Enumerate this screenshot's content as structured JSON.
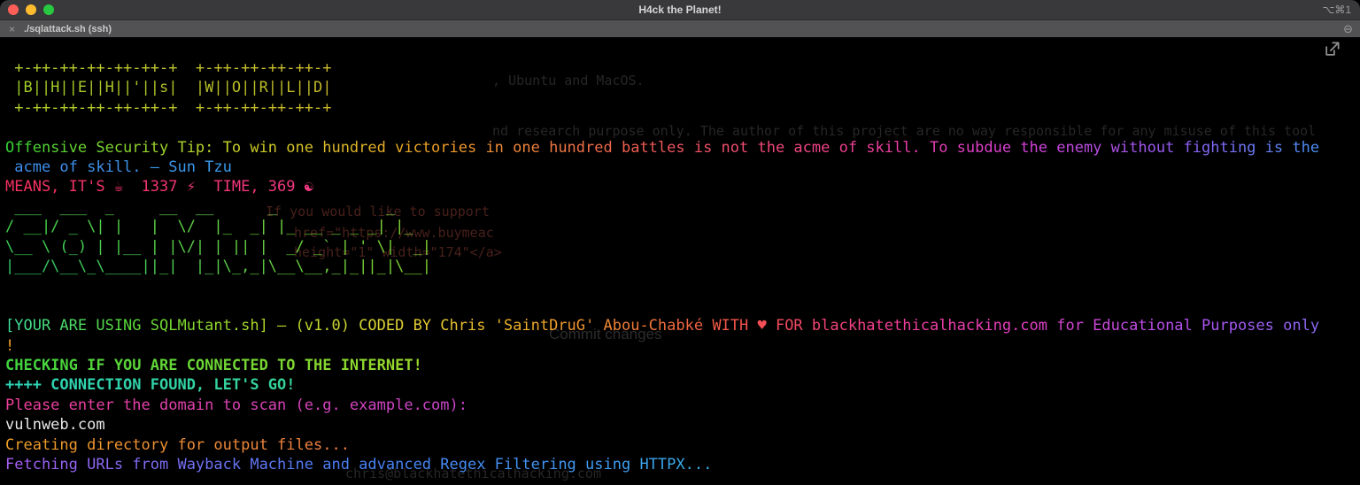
{
  "window": {
    "title": "H4ck the Planet!",
    "shortcut_hint": "⌥⌘1"
  },
  "tabbar": {
    "close_glyph": "×",
    "tab_title": "./sqlattack.sh (ssh)",
    "collapse_glyph": "⊖"
  },
  "palette": {
    "traffic_red": "#ff5f57",
    "traffic_yellow": "#febc2e",
    "traffic_green": "#28c840",
    "titlebar_bg": "#39393b",
    "tabbar_bg": "#525254",
    "terminal_bg": "#000000",
    "user_input_text": "#e8e8e8"
  },
  "terminal": {
    "lines": [
      {
        "text": " +-++-++-++-++-++-+  +-++-++-++-++-+"
      },
      {
        "text": " |B||H||E||H||'||s|  |W||O||R||L||D|"
      },
      {
        "text": " +-++-++-++-++-++-+  +-++-++-++-++-+"
      },
      {
        "text": ""
      },
      {
        "text": "Offensive Security Tip: To win one hundred victories in one hundred battles is not the acme of skill. To subdue the enemy without fighting is the"
      },
      {
        "text": " acme of skill. — Sun Tzu"
      },
      {
        "text": "MEANS, IT'S ☕  1337 ⚡  TIME, 369 ☯"
      },
      {
        "text": " ___  ___  _     __  __      _            _   "
      },
      {
        "text": "/ __|/ _ \\| |   |  \\/  |_  _| |_ __ _ _ _| |_ "
      },
      {
        "text": "\\__ \\ (_) | |__ | |\\/| | || |  _/ _` | ' \\|  _|"
      },
      {
        "text": "|___/\\__\\_\\____||_|  |_|\\_,_|\\__\\__,_|_||_|\\__|"
      },
      {
        "text": ""
      },
      {
        "text": ""
      },
      {
        "text": "[YOUR ARE USING SQLMutant.sh] — (v1.0) CODED BY Chris 'SaintDruG' Abou-Chabké WITH ♥ FOR blackhatethicalhacking.com for Educational Purposes only"
      },
      {
        "text": "!"
      },
      {
        "text": "CHECKING IF YOU ARE CONNECTED TO THE INTERNET!"
      },
      {
        "text": "++++ CONNECTION FOUND, LET'S GO!"
      },
      {
        "text": "Please enter the domain to scan (e.g. example.com):"
      },
      {
        "text": "vulnweb.com"
      },
      {
        "text": "Creating directory for output files..."
      },
      {
        "text": "Fetching URLs from Wayback Machine and advanced Regex Filtering using HTTPX..."
      }
    ],
    "ghost": [
      {
        "text": ", Ubuntu and MacOS."
      },
      {
        "text": "nd research purpose only. The author of this project are no way responsible for any misuse of this tool"
      },
      {
        "text": "If you would like to support"
      },
      {
        "text": "href=\"https://www.buymeac"
      },
      {
        "text": "height=\"1\" width=\"174\"</a>"
      },
      {
        "text": "Commit changes"
      },
      {
        "text": "chris@blackhatethicalhacking.com"
      }
    ]
  }
}
